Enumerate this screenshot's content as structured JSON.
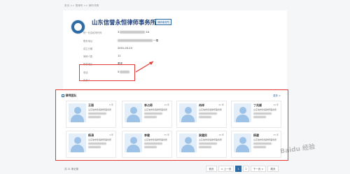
{
  "breadcrumb": "首页 >> 搜律所 >> 律所详情",
  "firm": {
    "name": "山东信誉永恒律师事务所",
    "tag": "律师事务所"
  },
  "info": [
    {
      "label": "统一社会信用代码",
      "value": "3",
      "value_suffix": "1A"
    },
    {
      "label": "联系地址",
      "value": "",
      "value_suffix": "一楼"
    },
    {
      "label": "成立日期",
      "value": "2001-03-23",
      "value_suffix": ""
    },
    {
      "label": "律师人数",
      "value": "11",
      "value_suffix": ""
    },
    {
      "label": "所属地区",
      "value": "泰安",
      "value_suffix": ""
    },
    {
      "label": "电话",
      "value": "5",
      "value_suffix": ""
    },
    {
      "label": "负责人",
      "value": "",
      "value_suffix": ""
    }
  ],
  "team": {
    "title": "律师团队",
    "more": "更多 >",
    "lawyers": [
      {
        "name": "王丽",
        "years": "6 年",
        "firm": "山东信誉永恒律师事务所",
        "status": "执业证号"
      },
      {
        "name": "李占奇",
        "years": "19 年",
        "firm": "山东信誉永恒律师事务所",
        "status": "执业证号"
      },
      {
        "name": "冉祥",
        "years": "22 年",
        "firm": "山东信誉永恒律师事务所",
        "status": "执业证号"
      },
      {
        "name": "丁兆顺",
        "years": "19 年",
        "firm": "山东信誉永恒律师事务所",
        "status": "执业证号"
      },
      {
        "name": "杨涛",
        "years": "4 年",
        "firm": "山东信誉永恒律师事务所",
        "status": "执业证号"
      },
      {
        "name": "李健",
        "years": "15 年",
        "firm": "山东信誉永恒律师事务所",
        "status": "执业证号"
      },
      {
        "name": "梁建民",
        "years": "19 年",
        "firm": "山东信誉永恒律师事务所",
        "status": "执业证号"
      },
      {
        "name": "杨建",
        "years": "15 年",
        "firm": "山东信誉永恒律师事务所",
        "status": "执业证号"
      }
    ]
  },
  "pagination": {
    "total": "共 11 条记录",
    "first": "首页",
    "prev": "< 上一页",
    "page1": "1",
    "page2": "2",
    "next": "下一页 >",
    "last": "尾页"
  },
  "watermark": "Baidu 经验",
  "colors": {
    "accent": "#2e6aa3",
    "highlight": "#e53935",
    "title": "#1f3f78"
  }
}
